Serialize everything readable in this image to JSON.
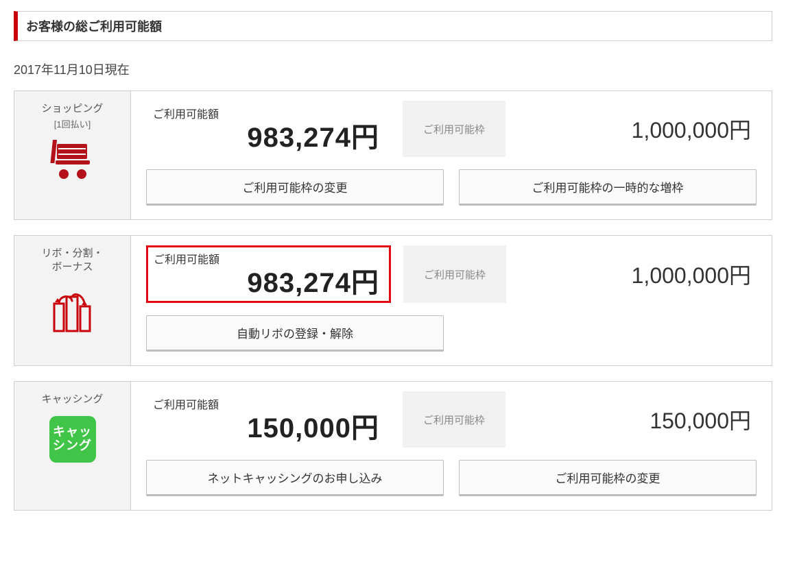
{
  "header": {
    "title": "お客様の総ご利用可能額"
  },
  "as_of": "2017年11月10日現在",
  "labels": {
    "available_amount": "ご利用可能額",
    "credit_limit": "ご利用可能枠"
  },
  "sections": {
    "shopping": {
      "title": "ショッピング",
      "subtitle": "[1回払い]",
      "available": "983,274円",
      "limit": "1,000,000円",
      "buttons": {
        "change_limit": "ご利用可能枠の変更",
        "temp_increase": "ご利用可能枠の一時的な増枠"
      }
    },
    "revolving": {
      "title": "リボ・分割・\nボーナス",
      "available": "983,274円",
      "limit": "1,000,000円",
      "buttons": {
        "auto_revo": "自動リボの登録・解除"
      }
    },
    "cashing": {
      "title": "キャッシング",
      "badge": "キャッ\nシング",
      "available": "150,000円",
      "limit": "150,000円",
      "buttons": {
        "apply_net_cashing": "ネットキャッシングのお申し込み",
        "change_limit": "ご利用可能枠の変更"
      }
    }
  }
}
